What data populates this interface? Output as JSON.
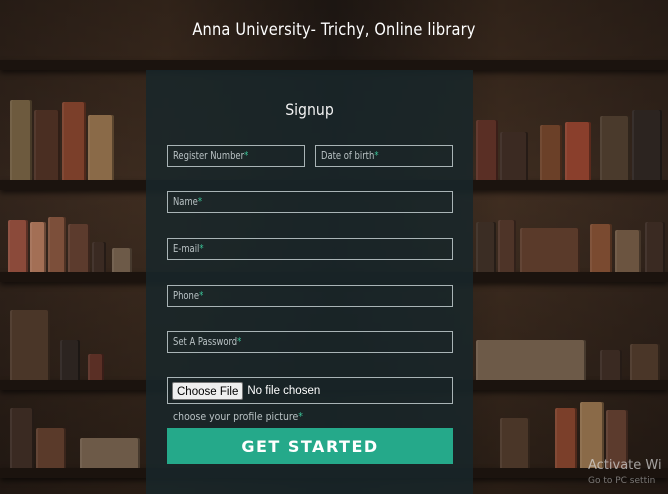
{
  "page": {
    "title": "Anna University- Trichy, Online library"
  },
  "form": {
    "heading": "Signup",
    "required_mark": "*",
    "fields": {
      "register_number": "Register Number",
      "date_of_birth": "Date of birth",
      "name": "Name",
      "email": "E-mail",
      "phone": "Phone",
      "password": "Set A Password"
    },
    "file": {
      "button_label": "Choose File",
      "status": "No file chosen",
      "hint": "choose your profile picture"
    },
    "submit_label": "GET STARTED"
  },
  "watermark": {
    "line1": "Activate Wi",
    "line2": "Go to PC settin"
  },
  "colors": {
    "accent": "#25a98a",
    "panel": "#18262a",
    "required": "#3cc69a"
  }
}
